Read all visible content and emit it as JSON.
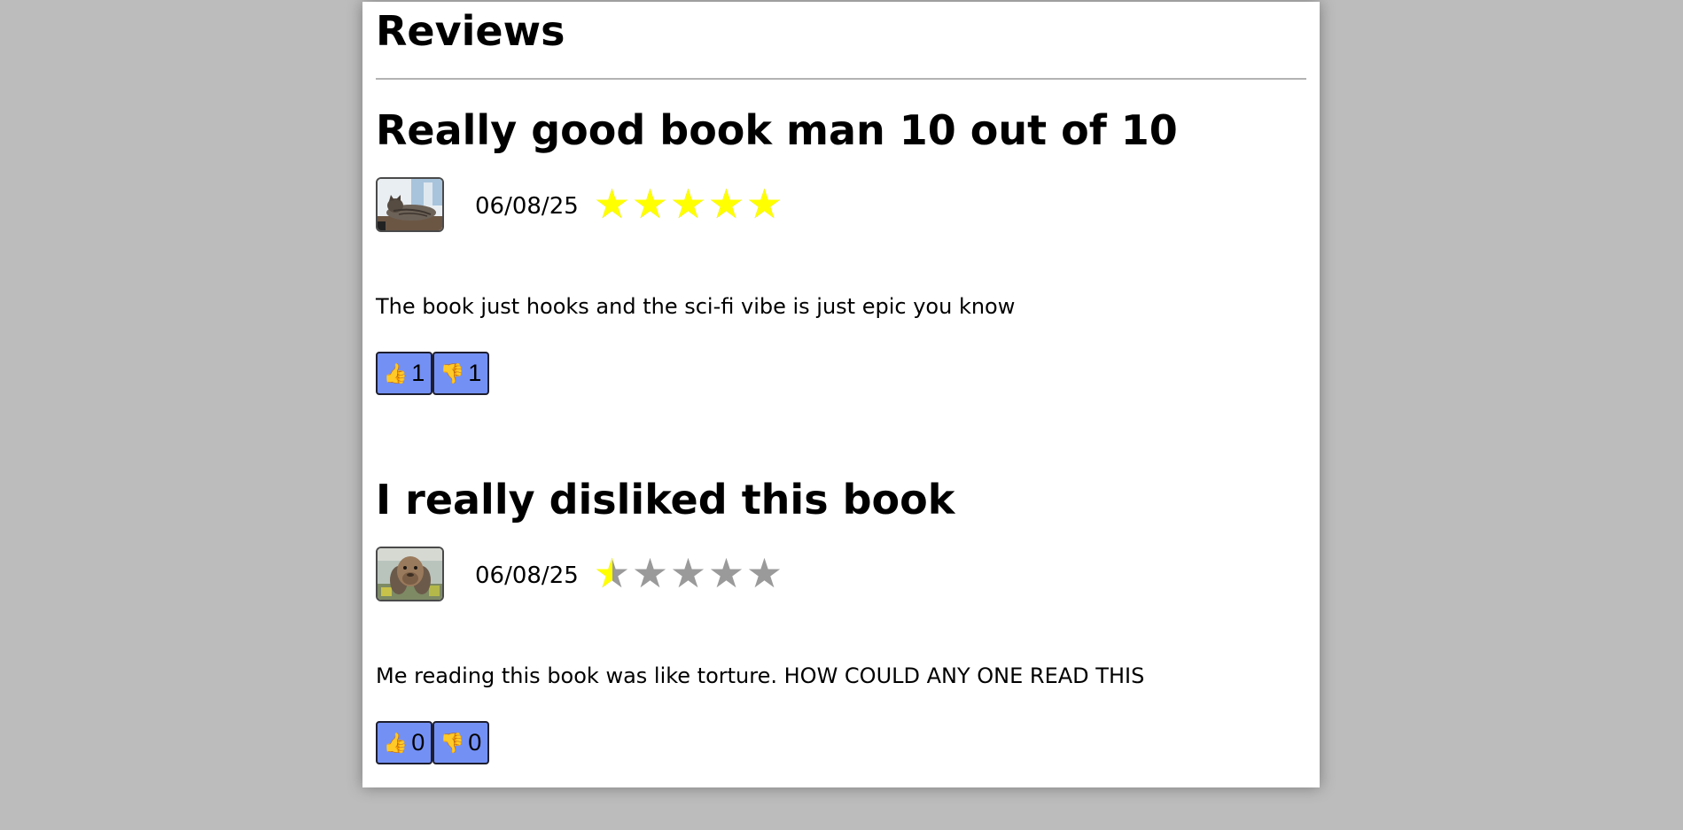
{
  "page": {
    "title": "Reviews"
  },
  "reviews": [
    {
      "title": "Really good book man 10 out of 10",
      "avatar": "cat-photo",
      "date": "06/08/25",
      "rating": 5,
      "rating_max": 5,
      "text": "The book just hooks and the sci-fi vibe is just epic you know",
      "likes": "1",
      "dislikes": "1"
    },
    {
      "title": "I really disliked this book",
      "avatar": "capybara-photo",
      "date": "06/08/25",
      "rating": 0.5,
      "rating_max": 5,
      "text": "Me reading this book was like torture. HOW COULD ANY ONE READ THIS",
      "likes": "0",
      "dislikes": "0"
    }
  ],
  "icons": {
    "like": "thumbs-up-icon",
    "dislike": "thumbs-down-icon",
    "star": "star-icon"
  },
  "colors": {
    "star_filled": "#ffff00",
    "star_empty": "#9a9a9a",
    "vote_button": "#7390f5",
    "background": "#bcbcbc"
  }
}
